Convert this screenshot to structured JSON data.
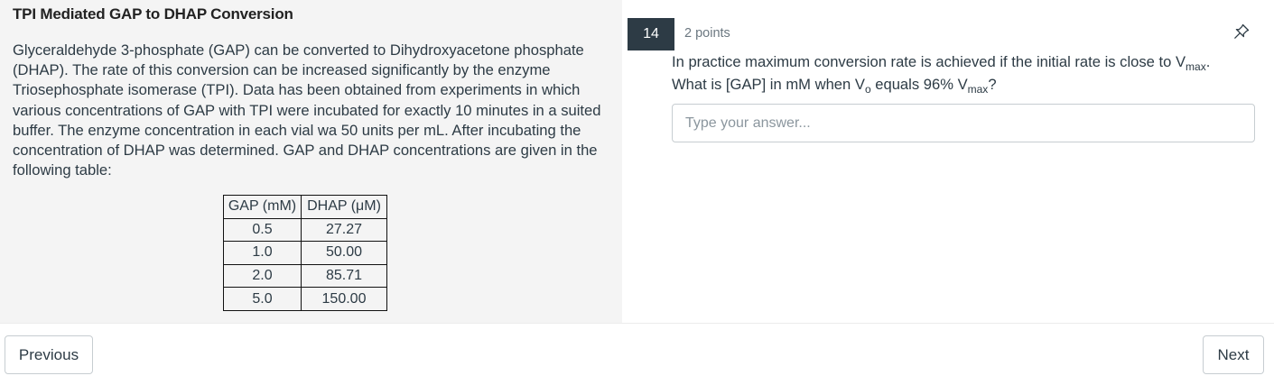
{
  "passage": {
    "title": "TPI Mediated GAP to DHAP Conversion",
    "body": "Glyceraldehyde 3-phosphate (GAP) can be converted to Dihydroxyacetone phosphate (DHAP). The rate of this conversion can be increased significantly by the enzyme Triosephosphate isomerase (TPI). Data has been obtained from experiments in which various concentrations of GAP with TPI were incubated for exactly 10 minutes in a suited buffer. The enzyme concentration in each vial wa 50 units per mL. After incubating the concentration of DHAP was determined. GAP and DHAP concentrations are given in the following table:",
    "table": {
      "headers": [
        "GAP (mM)",
        "DHAP (μM)"
      ],
      "rows": [
        [
          "0.5",
          "27.27"
        ],
        [
          "1.0",
          "50.00"
        ],
        [
          "2.0",
          "85.71"
        ],
        [
          "5.0",
          "150.00"
        ]
      ]
    }
  },
  "question": {
    "number": "14",
    "points": "2 points",
    "pin_icon": "pin-icon",
    "prompt": {
      "l1_a": "In practice maximum conversion rate is achieved if the initial rate is close to V",
      "l1_sub": "max",
      "l1_end": ".",
      "l2_a": "What is [GAP] in mM when V",
      "l2_sub1": "o",
      "l2_b": " equals 96% V",
      "l2_sub2": "max",
      "l2_end": "?"
    },
    "answer_value": "",
    "answer_placeholder": "Type your answer..."
  },
  "nav": {
    "previous_label": "Previous",
    "next_label": "Next"
  }
}
